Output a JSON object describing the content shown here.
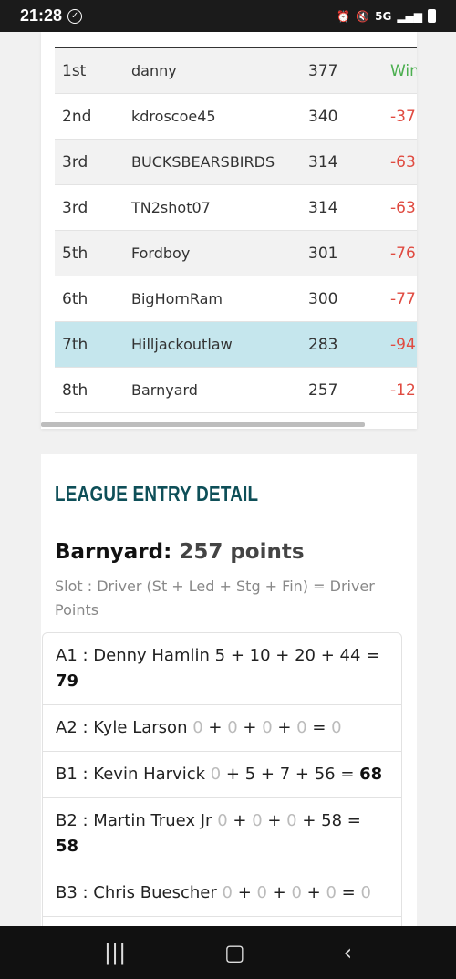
{
  "status_bar": {
    "time": "21:28",
    "network": "5G"
  },
  "standings": {
    "rows": [
      {
        "rank": "1st",
        "name": "danny",
        "points": "377",
        "diff": "Win",
        "style": "alt win"
      },
      {
        "rank": "2nd",
        "name": "kdroscoe45",
        "points": "340",
        "diff": "-37",
        "style": ""
      },
      {
        "rank": "3rd",
        "name": "BUCKSBEARSBIRDS",
        "points": "314",
        "diff": "-63",
        "style": "alt"
      },
      {
        "rank": "3rd",
        "name": "TN2shot07",
        "points": "314",
        "diff": "-63",
        "style": ""
      },
      {
        "rank": "5th",
        "name": "Fordboy",
        "points": "301",
        "diff": "-76",
        "style": "alt"
      },
      {
        "rank": "6th",
        "name": "BigHornRam",
        "points": "300",
        "diff": "-77",
        "style": ""
      },
      {
        "rank": "7th",
        "name": "Hilljackoutlaw",
        "points": "283",
        "diff": "-94",
        "style": "hl"
      },
      {
        "rank": "8th",
        "name": "Barnyard",
        "points": "257",
        "diff": "-12",
        "style": ""
      }
    ]
  },
  "detail": {
    "section_title": "LEAGUE ENTRY DETAIL",
    "entry_name": "Barnyard:",
    "entry_points": "257 points",
    "legend": "Slot : Driver (St + Led + Stg + Fin) = Driver Points",
    "slots": [
      {
        "label": "A1 : Denny Hamlin",
        "st": "5",
        "led": "10",
        "stg": "20",
        "fin": "44",
        "total": "79"
      },
      {
        "label": "A2 : Kyle Larson",
        "st": "0",
        "led": "0",
        "stg": "0",
        "fin": "0",
        "total": "0"
      },
      {
        "label": "B1 : Kevin Harvick",
        "st": "0",
        "led": "5",
        "stg": "7",
        "fin": "56",
        "total": "68"
      },
      {
        "label": "B2 : Martin Truex Jr",
        "st": "0",
        "led": "0",
        "stg": "0",
        "fin": "58",
        "total": "58"
      },
      {
        "label": "B3 : Chris Buescher",
        "st": "0",
        "led": "0",
        "stg": "0",
        "fin": "0",
        "total": "0"
      }
    ]
  },
  "colors": {
    "title": "#0e4f58",
    "negative": "#e04b41",
    "win": "#4caf50",
    "highlight": "#c5e6ed"
  }
}
